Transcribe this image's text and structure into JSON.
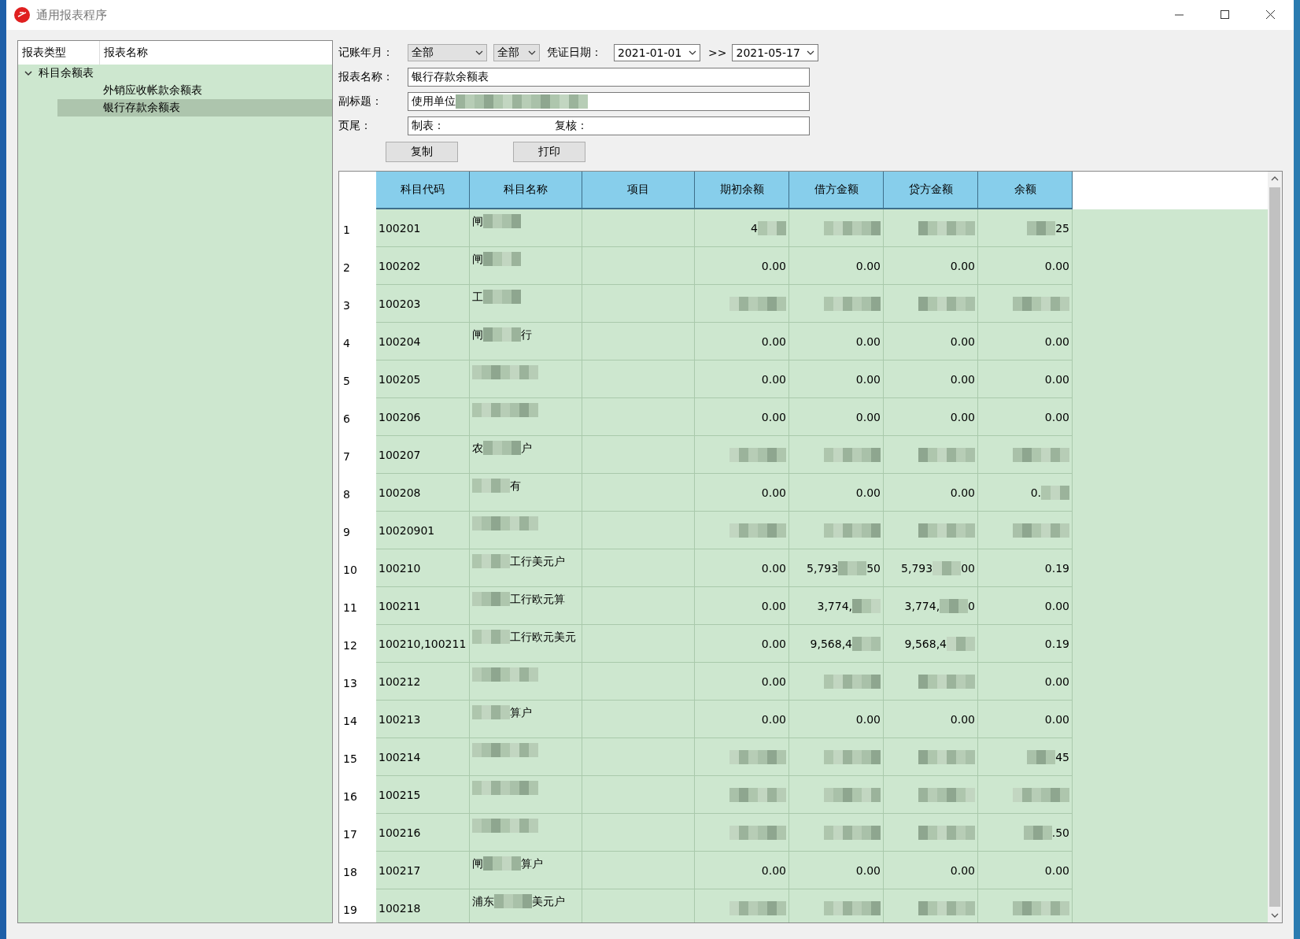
{
  "window": {
    "title": "通用报表程序"
  },
  "tree": {
    "columns": [
      "报表类型",
      "报表名称"
    ],
    "nodes": [
      {
        "label": "科目余额表",
        "expanded": true,
        "selected": false,
        "children": [
          {
            "label": "外销应收帐款余额表",
            "selected": false
          },
          {
            "label": "银行存款余额表",
            "selected": true
          }
        ]
      }
    ]
  },
  "form": {
    "period_label": "记账年月：",
    "period_year": "全部",
    "period_month": "全部",
    "date_label": "凭证日期：",
    "date_from": "2021-01-01",
    "date_sep": ">>",
    "date_to": "2021-05-17",
    "name_label": "报表名称：",
    "name_value": "银行存款余额表",
    "subtitle_label": "副标题：",
    "subtitle_value": "使用单位",
    "footer_label": "页尾：",
    "footer_values": [
      "制表：",
      "复核："
    ],
    "buttons": [
      "复制",
      "打印"
    ]
  },
  "table": {
    "columns": [
      "科目代码",
      "科目名称",
      "项目",
      "期初余额",
      "借方金额",
      "贷方金额",
      "余额"
    ],
    "rows": [
      {
        "number": "1",
        "cells": [
          [
            {
              "kind": "text",
              "text": "100201"
            }
          ],
          [
            {
              "kind": "text",
              "text": "闸"
            },
            {
              "kind": "mosaic"
            }
          ],
          [],
          [
            {
              "kind": "text",
              "text": "4"
            },
            {
              "kind": "mosaic"
            }
          ],
          [
            {
              "kind": "mosaic"
            }
          ],
          [
            {
              "kind": "mosaic"
            }
          ],
          [
            {
              "kind": "mosaic"
            },
            {
              "kind": "text",
              "text": "25"
            }
          ]
        ]
      },
      {
        "number": "2",
        "cells": [
          [
            {
              "kind": "text",
              "text": "100202"
            }
          ],
          [
            {
              "kind": "text",
              "text": "闸"
            },
            {
              "kind": "mosaic"
            }
          ],
          [],
          [
            {
              "kind": "text",
              "text": "0.00"
            }
          ],
          [
            {
              "kind": "text",
              "text": "0.00"
            }
          ],
          [
            {
              "kind": "text",
              "text": "0.00"
            }
          ],
          [
            {
              "kind": "text",
              "text": "0.00"
            }
          ]
        ]
      },
      {
        "number": "3",
        "cells": [
          [
            {
              "kind": "text",
              "text": "100203"
            }
          ],
          [
            {
              "kind": "text",
              "text": "工"
            },
            {
              "kind": "mosaic"
            }
          ],
          [],
          [
            {
              "kind": "mosaic"
            }
          ],
          [
            {
              "kind": "mosaic"
            }
          ],
          [
            {
              "kind": "mosaic"
            }
          ],
          [
            {
              "kind": "mosaic"
            }
          ]
        ]
      },
      {
        "number": "4",
        "cells": [
          [
            {
              "kind": "text",
              "text": "100204"
            }
          ],
          [
            {
              "kind": "text",
              "text": "闸"
            },
            {
              "kind": "mosaic"
            },
            {
              "kind": "text",
              "text": "行"
            }
          ],
          [],
          [
            {
              "kind": "text",
              "text": "0.00"
            }
          ],
          [
            {
              "kind": "text",
              "text": "0.00"
            }
          ],
          [
            {
              "kind": "text",
              "text": "0.00"
            }
          ],
          [
            {
              "kind": "text",
              "text": "0.00"
            }
          ]
        ]
      },
      {
        "number": "5",
        "cells": [
          [
            {
              "kind": "text",
              "text": "100205"
            }
          ],
          [
            {
              "kind": "mosaic"
            }
          ],
          [],
          [
            {
              "kind": "text",
              "text": "0.00"
            }
          ],
          [
            {
              "kind": "text",
              "text": "0.00"
            }
          ],
          [
            {
              "kind": "text",
              "text": "0.00"
            }
          ],
          [
            {
              "kind": "text",
              "text": "0.00"
            }
          ]
        ]
      },
      {
        "number": "6",
        "cells": [
          [
            {
              "kind": "text",
              "text": "100206"
            }
          ],
          [
            {
              "kind": "mosaic"
            }
          ],
          [],
          [
            {
              "kind": "text",
              "text": "0.00"
            }
          ],
          [
            {
              "kind": "text",
              "text": "0.00"
            }
          ],
          [
            {
              "kind": "text",
              "text": "0.00"
            }
          ],
          [
            {
              "kind": "text",
              "text": "0.00"
            }
          ]
        ]
      },
      {
        "number": "7",
        "cells": [
          [
            {
              "kind": "text",
              "text": "100207"
            }
          ],
          [
            {
              "kind": "text",
              "text": "农"
            },
            {
              "kind": "mosaic"
            },
            {
              "kind": "text",
              "text": "户"
            }
          ],
          [],
          [
            {
              "kind": "mosaic"
            }
          ],
          [
            {
              "kind": "mosaic"
            }
          ],
          [
            {
              "kind": "mosaic"
            }
          ],
          [
            {
              "kind": "mosaic"
            }
          ]
        ]
      },
      {
        "number": "8",
        "cells": [
          [
            {
              "kind": "text",
              "text": "100208"
            }
          ],
          [
            {
              "kind": "mosaic"
            },
            {
              "kind": "text",
              "text": "有"
            }
          ],
          [],
          [
            {
              "kind": "text",
              "text": "0.00"
            }
          ],
          [
            {
              "kind": "text",
              "text": "0.00"
            }
          ],
          [
            {
              "kind": "text",
              "text": "0.00"
            }
          ],
          [
            {
              "kind": "text",
              "text": "0."
            },
            {
              "kind": "mosaic"
            }
          ]
        ]
      },
      {
        "number": "9",
        "cells": [
          [
            {
              "kind": "text",
              "text": "10020901"
            }
          ],
          [
            {
              "kind": "mosaic"
            }
          ],
          [],
          [
            {
              "kind": "mosaic"
            }
          ],
          [
            {
              "kind": "mosaic"
            }
          ],
          [
            {
              "kind": "mosaic"
            }
          ],
          [
            {
              "kind": "mosaic"
            }
          ]
        ]
      },
      {
        "number": "10",
        "cells": [
          [
            {
              "kind": "text",
              "text": "100210"
            }
          ],
          [
            {
              "kind": "mosaic"
            },
            {
              "kind": "text",
              "text": "工行美元"
            },
            {
              "kind": "text",
              "text": "户"
            }
          ],
          [],
          [
            {
              "kind": "text",
              "text": "0.00"
            }
          ],
          [
            {
              "kind": "text",
              "text": "5,793"
            },
            {
              "kind": "mosaic"
            },
            {
              "kind": "text",
              "text": "50"
            }
          ],
          [
            {
              "kind": "text",
              "text": "5,793"
            },
            {
              "kind": "mosaic"
            },
            {
              "kind": "text",
              "text": "00"
            }
          ],
          [
            {
              "kind": "text",
              "text": "0.19"
            }
          ]
        ]
      },
      {
        "number": "11",
        "cells": [
          [
            {
              "kind": "text",
              "text": "100211"
            }
          ],
          [
            {
              "kind": "mosaic"
            },
            {
              "kind": "text",
              "text": "工行欧元"
            },
            {
              "kind": "text",
              "text": "算"
            }
          ],
          [],
          [
            {
              "kind": "text",
              "text": "0.00"
            }
          ],
          [
            {
              "kind": "text",
              "text": "3,774,"
            },
            {
              "kind": "mosaic"
            }
          ],
          [
            {
              "kind": "text",
              "text": "3,774,"
            },
            {
              "kind": "mosaic"
            },
            {
              "kind": "text",
              "text": "0"
            }
          ],
          [
            {
              "kind": "text",
              "text": "0.00"
            }
          ]
        ]
      },
      {
        "number": "12",
        "cells": [
          [
            {
              "kind": "text",
              "text": "100210,100211"
            }
          ],
          [
            {
              "kind": "mosaic"
            },
            {
              "kind": "text",
              "text": "工行欧元美元"
            }
          ],
          [],
          [
            {
              "kind": "text",
              "text": "0.00"
            }
          ],
          [
            {
              "kind": "text",
              "text": "9,568,4"
            },
            {
              "kind": "mosaic"
            }
          ],
          [
            {
              "kind": "text",
              "text": "9,568,4"
            },
            {
              "kind": "mosaic"
            }
          ],
          [
            {
              "kind": "text",
              "text": "0.19"
            }
          ]
        ]
      },
      {
        "number": "13",
        "cells": [
          [
            {
              "kind": "text",
              "text": "100212"
            }
          ],
          [
            {
              "kind": "mosaic"
            }
          ],
          [],
          [
            {
              "kind": "text",
              "text": "0.00"
            }
          ],
          [
            {
              "kind": "mosaic"
            }
          ],
          [
            {
              "kind": "mosaic"
            }
          ],
          [
            {
              "kind": "text",
              "text": "0.00"
            }
          ]
        ]
      },
      {
        "number": "14",
        "cells": [
          [
            {
              "kind": "text",
              "text": "100213"
            }
          ],
          [
            {
              "kind": "mosaic"
            },
            {
              "kind": "text",
              "text": "算"
            },
            {
              "kind": "text",
              "text": "户"
            }
          ],
          [],
          [
            {
              "kind": "text",
              "text": "0.00"
            }
          ],
          [
            {
              "kind": "text",
              "text": "0.00"
            }
          ],
          [
            {
              "kind": "text",
              "text": "0.00"
            }
          ],
          [
            {
              "kind": "text",
              "text": "0.00"
            }
          ]
        ]
      },
      {
        "number": "15",
        "cells": [
          [
            {
              "kind": "text",
              "text": "100214"
            }
          ],
          [
            {
              "kind": "mosaic"
            }
          ],
          [],
          [
            {
              "kind": "mosaic"
            }
          ],
          [
            {
              "kind": "mosaic"
            }
          ],
          [
            {
              "kind": "mosaic"
            }
          ],
          [
            {
              "kind": "mosaic"
            },
            {
              "kind": "text",
              "text": "45"
            }
          ]
        ]
      },
      {
        "number": "16",
        "cells": [
          [
            {
              "kind": "text",
              "text": "100215"
            }
          ],
          [
            {
              "kind": "mosaic"
            }
          ],
          [],
          [
            {
              "kind": "mosaic"
            }
          ],
          [
            {
              "kind": "mosaic"
            }
          ],
          [
            {
              "kind": "mosaic"
            }
          ],
          [
            {
              "kind": "mosaic"
            }
          ]
        ]
      },
      {
        "number": "17",
        "cells": [
          [
            {
              "kind": "text",
              "text": "100216"
            }
          ],
          [
            {
              "kind": "mosaic"
            }
          ],
          [],
          [
            {
              "kind": "mosaic"
            }
          ],
          [
            {
              "kind": "mosaic"
            }
          ],
          [
            {
              "kind": "mosaic"
            }
          ],
          [
            {
              "kind": "mosaic"
            },
            {
              "kind": "text",
              "text": ".50"
            }
          ]
        ]
      },
      {
        "number": "18",
        "cells": [
          [
            {
              "kind": "text",
              "text": "100217"
            }
          ],
          [
            {
              "kind": "text",
              "text": "闸"
            },
            {
              "kind": "mosaic"
            },
            {
              "kind": "text",
              "text": "算户"
            }
          ],
          [],
          [
            {
              "kind": "text",
              "text": "0.00"
            }
          ],
          [
            {
              "kind": "text",
              "text": "0.00"
            }
          ],
          [
            {
              "kind": "text",
              "text": "0.00"
            }
          ],
          [
            {
              "kind": "text",
              "text": "0.00"
            }
          ]
        ]
      },
      {
        "number": "19",
        "cells": [
          [
            {
              "kind": "text",
              "text": "100218"
            }
          ],
          [
            {
              "kind": "text",
              "text": "浦东"
            },
            {
              "kind": "mosaic"
            },
            {
              "kind": "text",
              "text": "美元户"
            }
          ],
          [],
          [
            {
              "kind": "mosaic"
            }
          ],
          [
            {
              "kind": "mosaic"
            }
          ],
          [
            {
              "kind": "mosaic"
            }
          ],
          [
            {
              "kind": "mosaic"
            }
          ]
        ]
      }
    ]
  }
}
